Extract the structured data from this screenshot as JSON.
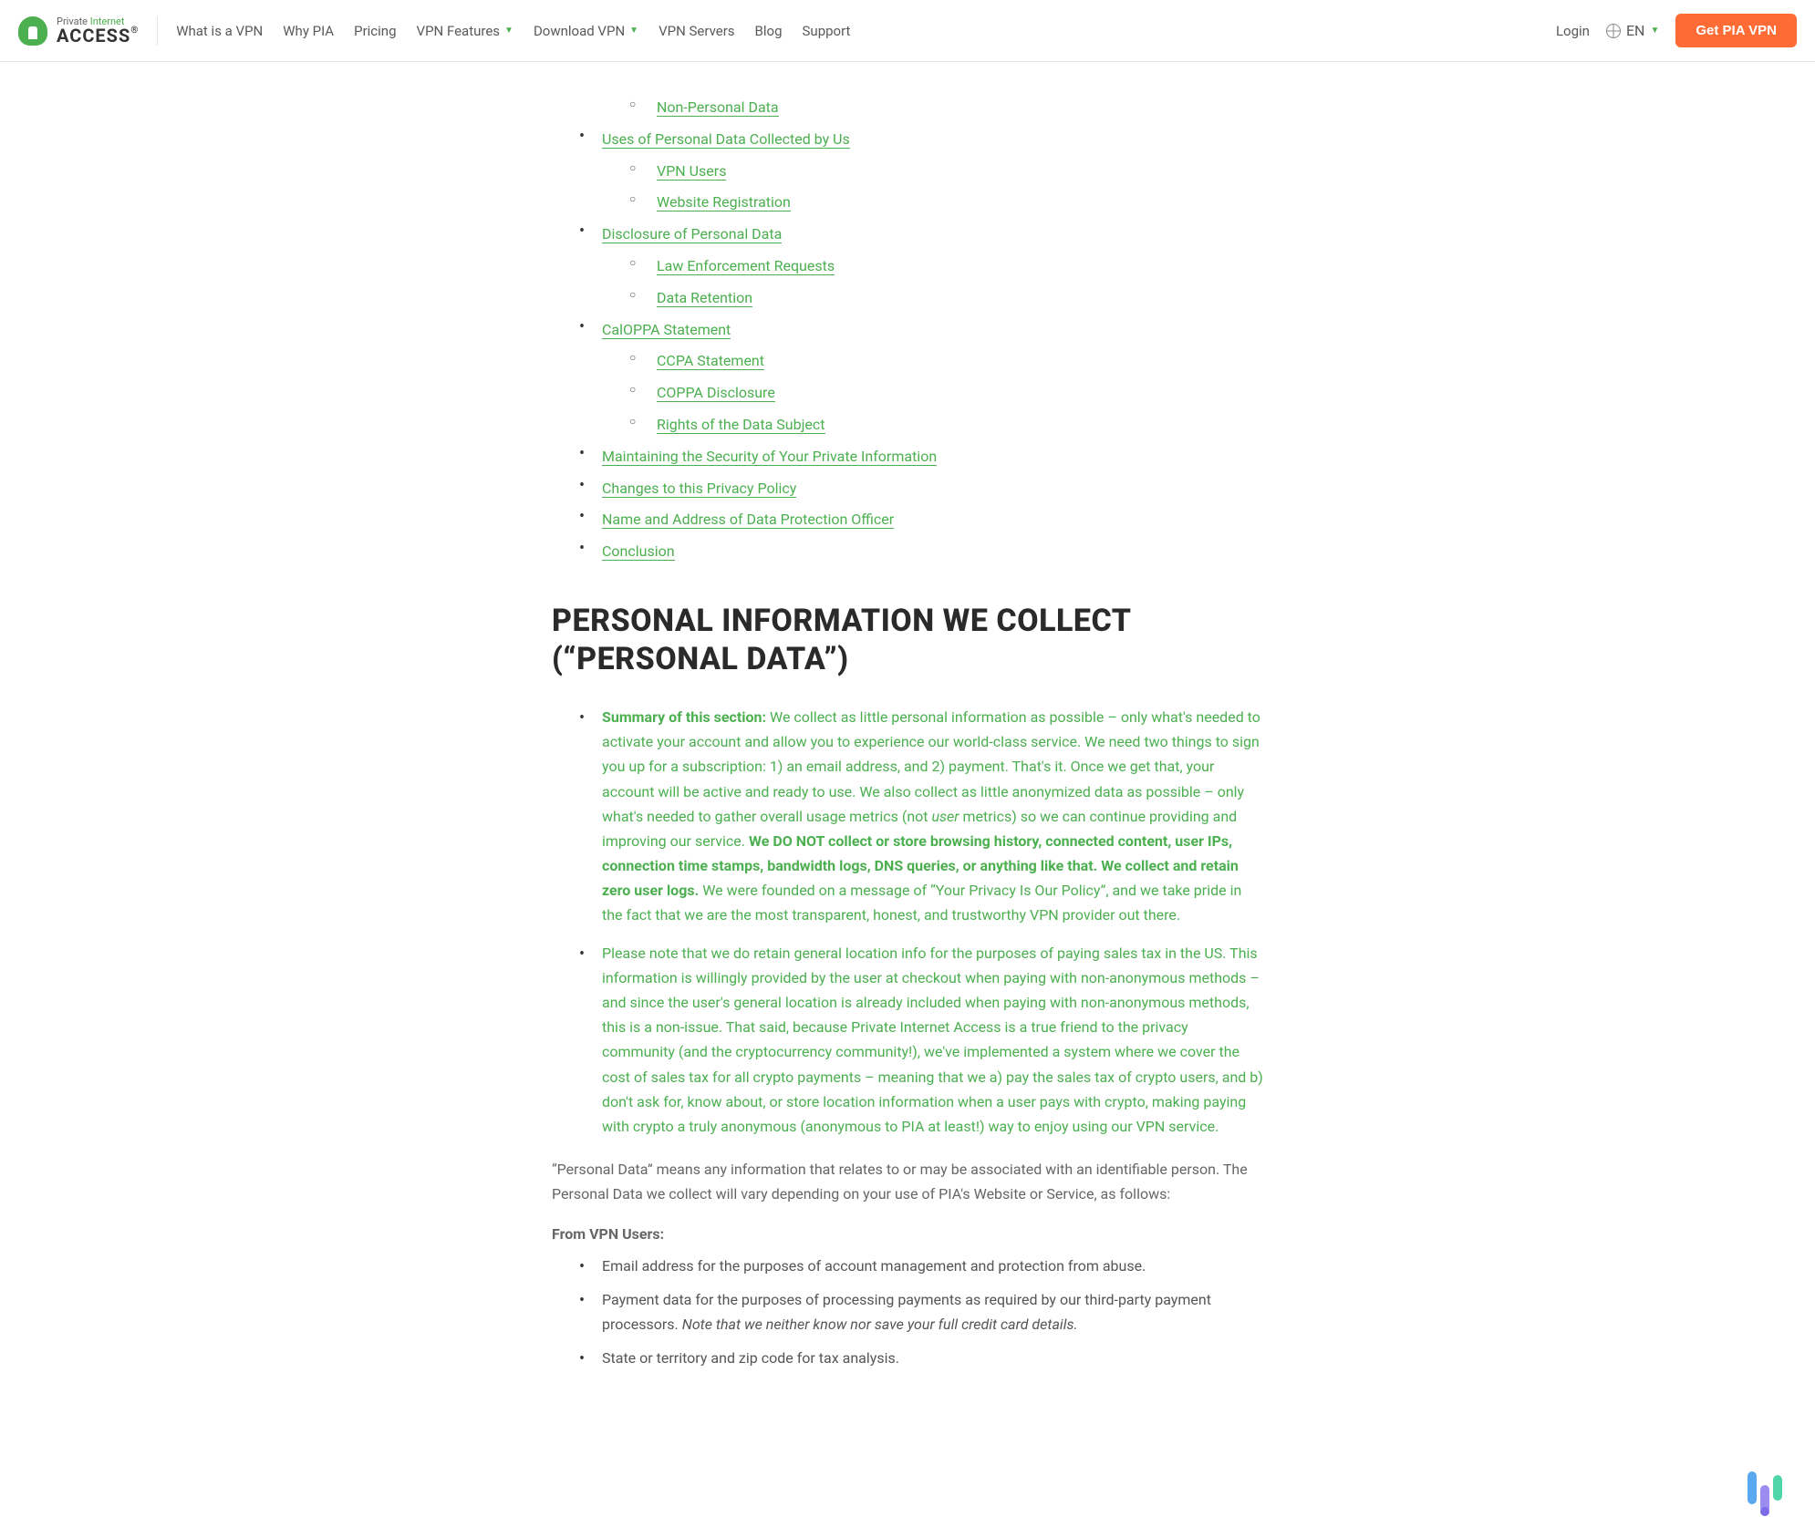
{
  "header": {
    "logo": {
      "top_private": "Private",
      "top_internet": "Internet",
      "bottom": "ACCESS",
      "reg": "®"
    },
    "nav": [
      {
        "label": "What is a VPN",
        "dropdown": false
      },
      {
        "label": "Why PIA",
        "dropdown": false
      },
      {
        "label": "Pricing",
        "dropdown": false
      },
      {
        "label": "VPN Features",
        "dropdown": true
      },
      {
        "label": "Download VPN",
        "dropdown": true
      },
      {
        "label": "VPN Servers",
        "dropdown": false
      },
      {
        "label": "Blog",
        "dropdown": false
      },
      {
        "label": "Support",
        "dropdown": false
      }
    ],
    "login": "Login",
    "lang": "EN",
    "cta": "Get PIA VPN"
  },
  "toc": [
    {
      "label": "Non-Personal Data",
      "indent": true,
      "standalone": true
    },
    {
      "label": "Uses of Personal Data Collected by Us",
      "children": [
        "VPN Users",
        "Website Registration"
      ]
    },
    {
      "label": "Disclosure of Personal Data",
      "children": [
        "Law Enforcement Requests",
        "Data Retention"
      ]
    },
    {
      "label": "CalOPPA Statement",
      "children": [
        "CCPA Statement",
        "COPPA Disclosure",
        "Rights of the Data Subject"
      ]
    },
    {
      "label": "Maintaining the Security of Your Private Information"
    },
    {
      "label": "Changes to this Privacy Policy"
    },
    {
      "label": "Name and Address of Data Protection Officer"
    },
    {
      "label": "Conclusion"
    }
  ],
  "section_title": "PERSONAL INFORMATION WE COLLECT (“PERSONAL DATA”)",
  "summary": {
    "label": "Summary of this section: ",
    "p1a": "We collect as little personal information as possible – only what's needed to activate your account and allow you to experience our world-class service. We need two things to sign you up for a subscription: 1) an email address, and 2) payment. That's it. Once we get that, your account will be active and ready to use. We also collect as little anonymized data as possible – only what's needed to gather overall usage metrics (not ",
    "user_italic": "user",
    "p1b": " metrics) so we can continue providing and improving our service. ",
    "bold1": "We DO NOT collect or store browsing history, connected content, user IPs, connection time stamps, bandwidth logs, DNS queries, or anything like that. We collect and retain zero user logs.",
    "p1c": " We were founded on a message of “Your Privacy Is Our Policy”, and we take pride in the fact that we are the most transparent, honest, and trustworthy VPN provider out there.",
    "p2": "Please note that we do retain general location info for the purposes of paying sales tax in the US. This information is willingly provided by the user at checkout when paying with non-anonymous methods – and since the user's general location is already included when paying with non-anonymous methods, this is a non-issue. That said, because Private Internet Access is a true friend to the privacy community (and the cryptocurrency community!), we've implemented a system where we cover the cost of sales tax for all crypto payments – meaning that we a) pay the sales tax of crypto users, and b) don't ask for, know about, or store location information when a user pays with crypto, making paying with crypto a truly anonymous (anonymous to PIA at least!) way to enjoy using our VPN service."
  },
  "body1": "“Personal Data” means any information that relates to or may be associated with an identifiable person. The Personal Data we collect will vary depending on your use of PIA's Website or Service, as follows:",
  "sub_heading": "From VPN Users:",
  "bullets": {
    "b1": "Email address for the purposes of account management and protection from abuse.",
    "b2a": "Payment data for the purposes of processing payments as required by our third-party payment processors. ",
    "b2b": "Note that we neither know nor save your full credit card details.",
    "b3": "State or territory and zip code for tax analysis."
  }
}
